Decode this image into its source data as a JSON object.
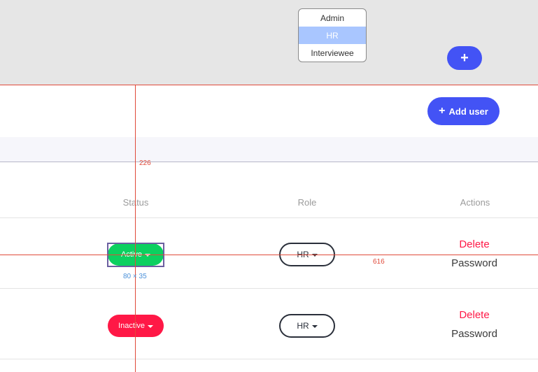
{
  "role_menu": {
    "options": [
      "Admin",
      "HR",
      "Interviewee"
    ],
    "selected": "HR"
  },
  "fab_icon": "plus-icon",
  "add_user": {
    "label": "Add user",
    "icon": "plus-icon"
  },
  "measurements": {
    "distance_top": "226",
    "distance_right": "616",
    "element_size": "80 × 35"
  },
  "table": {
    "headers": {
      "status": "Status",
      "role": "Role",
      "actions": "Actions"
    },
    "rows": [
      {
        "status": "Active",
        "role": "HR",
        "delete": "Delete",
        "password": "Password"
      },
      {
        "status": "Inactive",
        "role": "HR",
        "delete": "Delete",
        "password": "Password"
      }
    ]
  },
  "colors": {
    "accent": "#4353f5",
    "active": "#0cd05f",
    "inactive": "#ff1846",
    "guide": "#e04a3a"
  }
}
